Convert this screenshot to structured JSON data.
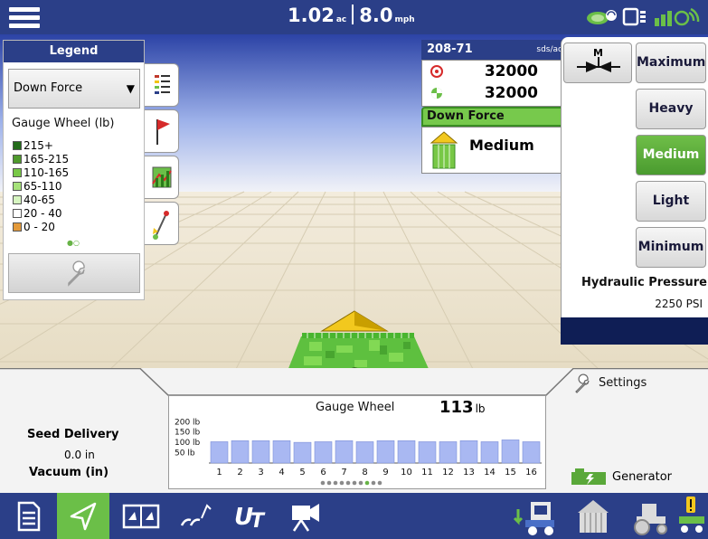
{
  "topbar": {
    "area_value": "1.02",
    "area_unit": "ac",
    "speed_value": "8.0",
    "speed_unit": "mph"
  },
  "legend": {
    "title": "Legend",
    "dropdown_value": "Down Force",
    "subtitle": "Gauge Wheel (lb)",
    "ranges": [
      {
        "label": "215+",
        "color": "#236b1a"
      },
      {
        "label": "165-215",
        "color": "#4f9a2d"
      },
      {
        "label": "110-165",
        "color": "#78c846"
      },
      {
        "label": "65-110",
        "color": "#a6e27a"
      },
      {
        "label": "40-65",
        "color": "#d6f5c0"
      },
      {
        "label": "20 - 40",
        "color": "#ffffff"
      },
      {
        "label": "0 - 20",
        "color": "#e39a3b"
      }
    ],
    "page_dots": "●○"
  },
  "seed_panel": {
    "product": "208-71",
    "unit": "sds/ac",
    "target_rate": "32000",
    "actual_rate": "32000",
    "down_force_label": "Down Force",
    "down_force_value": "Medium"
  },
  "right_panel": {
    "m_label": "M",
    "levels": [
      "Maximum",
      "Heavy",
      "Medium",
      "Light",
      "Minimum"
    ],
    "active_level": "Medium",
    "hydraulic_label": "Hydraulic Pressure",
    "hydraulic_value": "2250 PSI"
  },
  "bottom": {
    "settings_label": "Settings",
    "seed_delivery_label": "Seed Delivery",
    "seed_delivery_value": "0.0 in",
    "vacuum_label": "Vacuum (in)",
    "generator_label": "Generator"
  },
  "chart_data": {
    "type": "bar",
    "title": "Gauge Wheel",
    "current_value": "113",
    "current_unit": "lb",
    "categories": [
      "1",
      "2",
      "3",
      "4",
      "5",
      "6",
      "7",
      "8",
      "9",
      "10",
      "11",
      "12",
      "13",
      "14",
      "15",
      "16"
    ],
    "values": [
      103,
      108,
      108,
      108,
      100,
      103,
      108,
      103,
      108,
      108,
      103,
      103,
      108,
      103,
      112,
      103
    ],
    "y_ticks": [
      "200 lb",
      "150 lb",
      "100 lb",
      "50 lb"
    ],
    "y_tick_values": [
      200,
      150,
      100,
      50
    ],
    "ylim": [
      0,
      210
    ],
    "bar_color": "#a9b8f2",
    "page_dots": [
      false,
      false,
      false,
      false,
      false,
      false,
      false,
      true,
      false,
      false
    ]
  },
  "colors": {
    "brand_blue": "#2b3f88",
    "active_green": "#6bbf48",
    "dark_navy": "#0f1e55"
  },
  "bottom_nav": [
    {
      "name": "summary-icon",
      "active": false
    },
    {
      "name": "guidance-icon",
      "active": true
    },
    {
      "name": "split-screen-icon",
      "active": false
    },
    {
      "name": "planting-icon",
      "active": false
    },
    {
      "name": "ut-icon",
      "active": false
    },
    {
      "name": "camera-icon",
      "active": false
    },
    {
      "name": "planter-icon",
      "active": false
    },
    {
      "name": "bin-icon",
      "active": false
    },
    {
      "name": "tractor-icon",
      "active": false
    },
    {
      "name": "alarm-icon",
      "active": false
    }
  ]
}
